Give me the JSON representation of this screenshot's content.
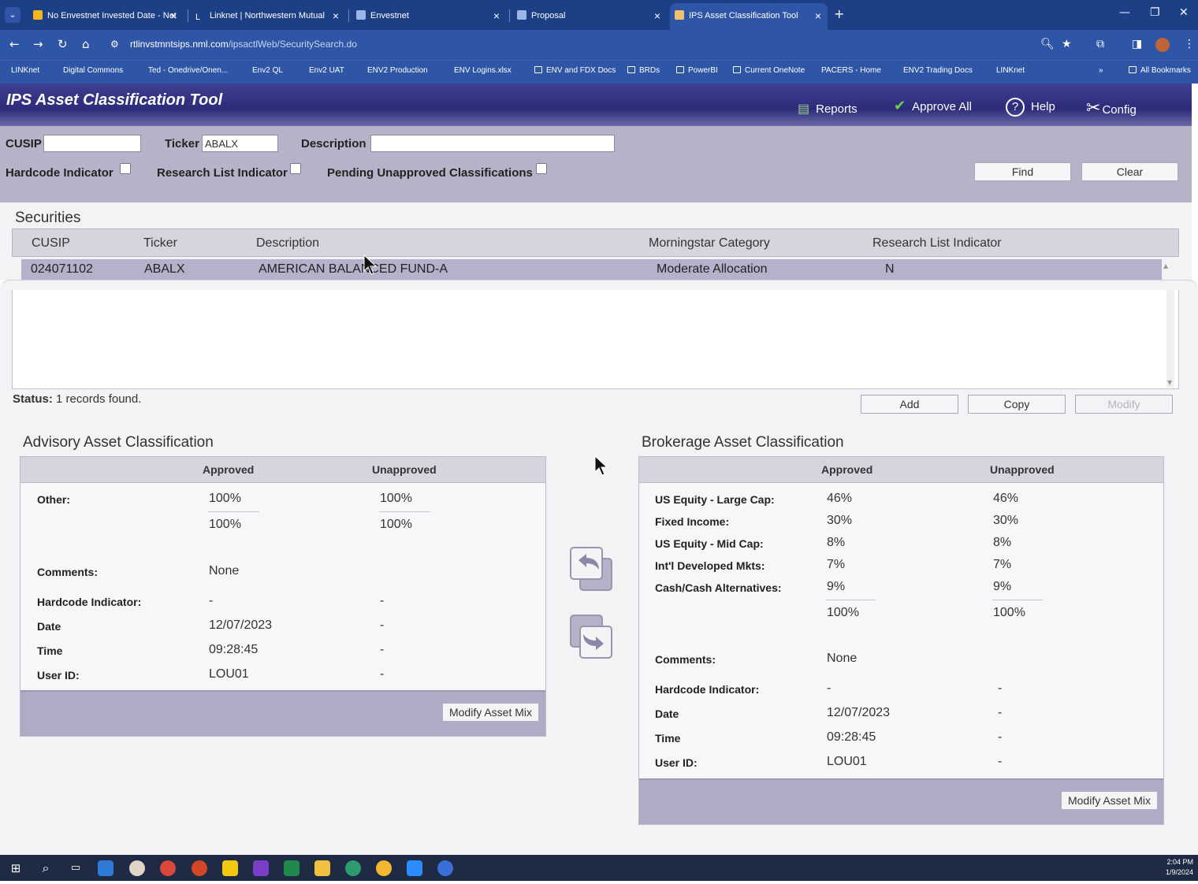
{
  "browser": {
    "tabs": [
      {
        "label": "No Envestnet Invested Date - Net",
        "icon_color": "#f5b51c"
      },
      {
        "label": "Linknet | Northwestern Mutual",
        "icon_color": "#ffffff"
      },
      {
        "label": "Envestnet",
        "icon_color": "#9db6e8"
      },
      {
        "label": "Proposal",
        "icon_color": "#9db6e8"
      },
      {
        "label": "IPS Asset Classification Tool",
        "icon_color": "#f0c070"
      }
    ],
    "url_host": "rtlinvstmntsips.nml.com",
    "url_path": "/ipsactlWeb/SecuritySearch.do",
    "bookmarks": [
      "LINKnet",
      "Digital Commons",
      "Ted - Onedrive/Onen...",
      "Env2 QL",
      "Env2 UAT",
      "ENV2 Production",
      "ENV Logins.xlsx",
      "ENV and FDX Docs",
      "BRDs",
      "PowerBI",
      "Current OneNote",
      "PACERS - Home",
      "ENV2 Trading Docs",
      "LINKnet"
    ],
    "all_bookmarks": "All Bookmarks",
    "more": "»"
  },
  "app": {
    "title": "IPS Asset Classification Tool",
    "header_buttons": {
      "reports": "Reports",
      "approve_all": "Approve All",
      "help": "Help",
      "config": "Config"
    }
  },
  "search": {
    "cusip_label": "CUSIP",
    "cusip_value": "",
    "ticker_label": "Ticker",
    "ticker_value": "ABALX",
    "description_label": "Description",
    "description_value": "",
    "hardcode_label": "Hardcode Indicator",
    "research_label": "Research List Indicator",
    "pending_label": "Pending Unapproved Classifications",
    "find_label": "Find",
    "clear_label": "Clear"
  },
  "securities": {
    "title": "Securities",
    "columns": [
      "CUSIP",
      "Ticker",
      "Description",
      "Morningstar Category",
      "Research List Indicator"
    ],
    "rows": [
      {
        "cusip": "024071102",
        "ticker": "ABALX",
        "description": "AMERICAN BALANCED FUND-A",
        "category": "Moderate Allocation",
        "research": "N"
      }
    ]
  },
  "status": {
    "label": "Status:",
    "text": "1 records found."
  },
  "actions": {
    "add": "Add",
    "copy": "Copy",
    "modify": "Modify"
  },
  "advisory": {
    "title": "Advisory Asset Classification",
    "col_approved": "Approved",
    "col_unapproved": "Unapproved",
    "rows": [
      {
        "label": "Other:",
        "approved": "100%",
        "unapproved": "100%"
      }
    ],
    "total_approved": "100%",
    "total_unapproved": "100%",
    "comments_label": "Comments:",
    "comments": "None",
    "hardcode_label": "Hardcode Indicator:",
    "hardcode_approved": "-",
    "hardcode_unapproved": "-",
    "date_label": "Date",
    "date_approved": "12/07/2023",
    "date_unapproved": "-",
    "time_label": "Time",
    "time_approved": "09:28:45",
    "time_unapproved": "-",
    "user_label": "User ID:",
    "user_approved": "LOU01",
    "user_unapproved": "-",
    "modify_label": "Modify Asset Mix"
  },
  "brokerage": {
    "title": "Brokerage Asset Classification",
    "col_approved": "Approved",
    "col_unapproved": "Unapproved",
    "rows": [
      {
        "label": "US Equity - Large Cap:",
        "approved": "46%",
        "unapproved": "46%"
      },
      {
        "label": "Fixed Income:",
        "approved": "30%",
        "unapproved": "30%"
      },
      {
        "label": "US Equity - Mid Cap:",
        "approved": "8%",
        "unapproved": "8%"
      },
      {
        "label": "Int'l Developed Mkts:",
        "approved": "7%",
        "unapproved": "7%"
      },
      {
        "label": "Cash/Cash Alternatives:",
        "approved": "9%",
        "unapproved": "9%"
      }
    ],
    "total_approved": "100%",
    "total_unapproved": "100%",
    "comments_label": "Comments:",
    "comments": "None",
    "hardcode_label": "Hardcode Indicator:",
    "hardcode_approved": "-",
    "hardcode_unapproved": "-",
    "date_label": "Date",
    "date_approved": "12/07/2023",
    "date_unapproved": "-",
    "time_label": "Time",
    "time_approved": "09:28:45",
    "time_unapproved": "-",
    "user_label": "User ID:",
    "user_approved": "LOU01",
    "user_unapproved": "-",
    "modify_label": "Modify Asset Mix"
  },
  "taskbar": {
    "time": "2:04 PM",
    "date": "1/9/2024"
  },
  "colors": {
    "header_bg": "#2c2c7a",
    "panel_bg": "#b8b2c8",
    "selected_row": "#b7b0ca",
    "browser_blue": "#2f56a6"
  }
}
